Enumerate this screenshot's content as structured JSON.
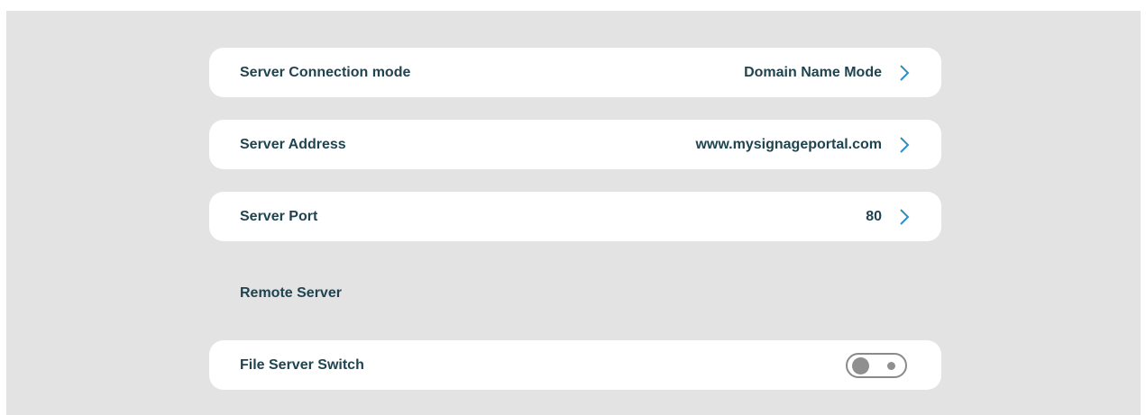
{
  "settings": {
    "rows": [
      {
        "label": "Server Connection mode",
        "value": "Domain Name Mode",
        "icon": "chevron-right-icon"
      },
      {
        "label": "Server Address",
        "value": "www.mysignageportal.com",
        "icon": "chevron-right-icon"
      },
      {
        "label": "Server Port",
        "value": "80",
        "icon": "chevron-right-icon"
      }
    ],
    "remote_section": {
      "title": "Remote Server"
    },
    "file_server": {
      "label": "File Server Switch",
      "enabled": false
    }
  },
  "colors": {
    "background": "#e3e3e3",
    "card": "#ffffff",
    "text": "#1f4450",
    "accent": "#2b8fc7",
    "toggle_off": "#8f8f8f"
  }
}
